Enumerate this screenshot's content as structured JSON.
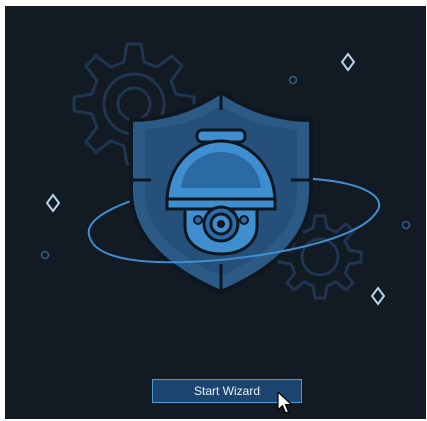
{
  "wizard": {
    "start_label": "Start Wizard"
  },
  "icons": {
    "hero": "security-shield-dome-camera-icon",
    "cursor": "mouse-pointer-icon"
  },
  "colors": {
    "background": "#121a24",
    "accent": "#4a9ad8",
    "button_fill": "#1c4670",
    "button_text": "#e9f1f8"
  }
}
